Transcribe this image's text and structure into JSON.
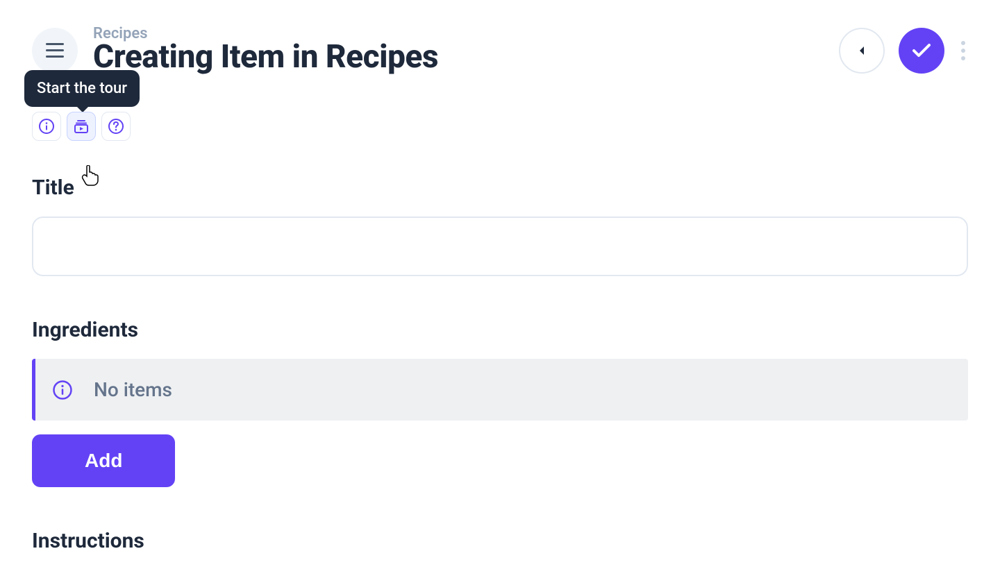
{
  "header": {
    "breadcrumb": "Recipes",
    "title": "Creating Item in Recipes"
  },
  "tooltip": {
    "text": "Start the tour"
  },
  "sections": {
    "title": {
      "label": "Title",
      "value": ""
    },
    "ingredients": {
      "label": "Ingredients",
      "empty_text": "No items",
      "add_label": "Add"
    },
    "instructions": {
      "label": "Instructions"
    }
  },
  "colors": {
    "accent": "#6342f5"
  }
}
